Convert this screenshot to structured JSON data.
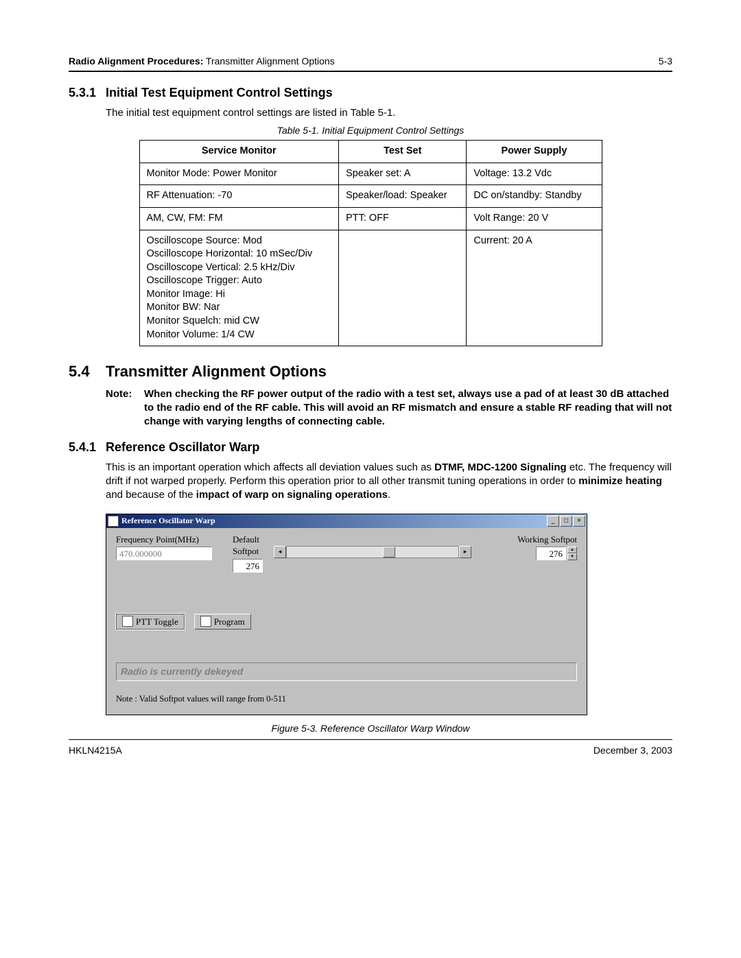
{
  "header": {
    "procedures": "Radio Alignment Procedures:",
    "sub": " Transmitter Alignment Options",
    "page": "5-3"
  },
  "s531": {
    "num": "5.3.1",
    "title": "Initial Test Equipment Control Settings",
    "intro": "The initial test equipment control settings are listed in Table 5-1."
  },
  "table": {
    "caption": "Table 5-1.  Initial Equipment Control Settings",
    "headers": [
      "Service Monitor",
      "Test Set",
      "Power Supply"
    ],
    "rows": [
      [
        "Monitor Mode: Power Monitor",
        "Speaker set: A",
        "Voltage: 13.2 Vdc"
      ],
      [
        "RF Attenuation: -70",
        "Speaker/load: Speaker",
        "DC on/standby: Standby"
      ],
      [
        "AM, CW, FM: FM",
        "PTT: OFF",
        "Volt Range: 20 V"
      ],
      [
        "multi",
        "",
        "Current: 20 A"
      ]
    ],
    "multi": [
      "Oscilloscope Source: Mod",
      "Oscilloscope Horizontal: 10 mSec/Div",
      "Oscilloscope Vertical: 2.5 kHz/Div",
      "Oscilloscope Trigger: Auto",
      "Monitor Image: Hi",
      "Monitor BW: Nar",
      "Monitor Squelch: mid CW",
      "Monitor Volume: 1/4 CW"
    ]
  },
  "s54": {
    "num": "5.4",
    "title": "Transmitter Alignment Options",
    "note_label": "Note:",
    "note": "When checking the RF power output of the radio with a test set, always use a pad of at least 30 dB attached to the radio end of the RF cable. This will avoid an RF mismatch and ensure a stable RF reading that will not change with varying lengths of connecting cable."
  },
  "s541": {
    "num": "5.4.1",
    "title": "Reference Oscillator Warp",
    "p1a": "This is an important operation which affects all deviation values such as ",
    "p1b": "DTMF, MDC-1200 Signaling",
    "p1c": " etc. The frequency will drift if not warped properly. Perform this operation prior to all other transmit tuning operations in order to ",
    "p1d": "minimize heating",
    "p1e": " and because of the ",
    "p1f": "impact of warp on signaling operations",
    "p1g": "."
  },
  "app": {
    "title": "Reference Oscillator Warp",
    "freq_label": "Frequency Point(MHz)",
    "freq_value": "470.000000",
    "default_label": "Default Softpot",
    "default_value": "276",
    "working_label": "Working Softpot",
    "working_value": "276",
    "ptt_btn": "PTT Toggle",
    "program_btn": "Program",
    "status": "Radio is currently dekeyed",
    "note": "Note : Valid Softpot values will range from 0-511"
  },
  "figure_caption": "Figure 5-3.  Reference Oscillator Warp Window",
  "footer": {
    "left": "HKLN4215A",
    "right": "December 3, 2003"
  }
}
